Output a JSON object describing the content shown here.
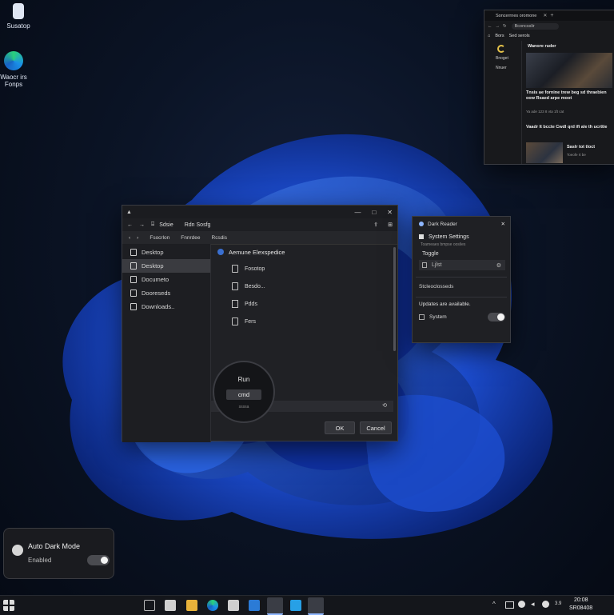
{
  "desktop": {
    "icons": [
      {
        "label": "Susatop"
      },
      {
        "label": "Waocr irs"
      },
      {
        "label": "Fonps"
      }
    ]
  },
  "browser": {
    "tab_title": "Soncerrnes oromone",
    "address": "Bconcsslir",
    "toolbar": [
      "Bors",
      "Sed serols"
    ],
    "sidebar": [
      "Bnoget",
      "Nnuer"
    ],
    "hero_title": "Wanore ruder",
    "headline1": "Tnsis ae fornine trew beg sd thraebien oow Rsaed arpe moot",
    "headline1_meta": "Ya ade 123 8 vta 1ft cat",
    "headline2": "Vaadr lt bccte Cwdl qrd ifi ale th ucrttie",
    "card_title": "Saslr tot tloct",
    "card_meta": "Toeofe rt be"
  },
  "explorer": {
    "title": "Rdn Sosfg",
    "crumbs": [
      "Fsocrlon",
      "Fnnrdee",
      "Rcsdis"
    ],
    "sidebar": [
      {
        "label": "Desktop"
      },
      {
        "label": "Desktop"
      },
      {
        "label": "Documeto"
      },
      {
        "label": "Dooreseds"
      },
      {
        "label": "Downloads.."
      }
    ],
    "section_title": "Aemune Elexspedice",
    "files": [
      {
        "label": "Fosotop"
      },
      {
        "label": "Besdo..."
      },
      {
        "label": "Pdds"
      },
      {
        "label": "Fers"
      }
    ],
    "run_label": "Run",
    "run_value": "cmd",
    "run_hint": "ssssa",
    "ok_label": "OK",
    "cancel_label": "Cancel"
  },
  "dark_reader": {
    "title": "Dark Reader",
    "section": "System Settings",
    "subtitle": "Toameaes bmpse ooslies",
    "toggle_label": "Toggle",
    "input_value": "Ljlst",
    "extra": "Stcleoclosseds",
    "updates": "Updates are available.",
    "system_label": "System"
  },
  "auto_dark": {
    "title": "Auto Dark Mode",
    "status": "Enabled"
  },
  "clock": {
    "time": "20:08",
    "date": "SR08408",
    "tray_num": "3.9"
  },
  "colors": {
    "accent": "#2d63d8",
    "bloom_deep": "#0b2a8e",
    "bloom_light": "#3e7cf3"
  }
}
